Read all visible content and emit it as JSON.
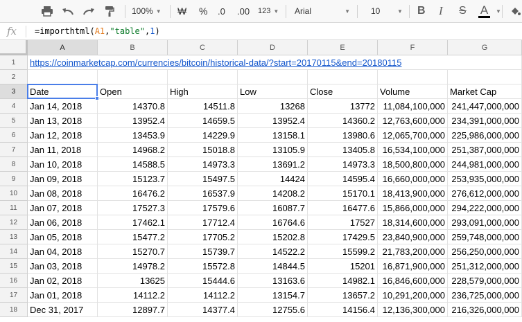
{
  "toolbar": {
    "zoom": "100%",
    "currency_symbol": "₩",
    "percent_symbol": "%",
    "decrease_decimals": ".0",
    "increase_decimals": ".00",
    "more_formats": "123",
    "font": "Arial",
    "font_size": "10",
    "bold": "B",
    "italic": "I",
    "strikethrough": "S",
    "text_color": "A"
  },
  "formula_bar": {
    "fx_label": "fx",
    "formula_parts": [
      "=importhtml(",
      "A1",
      ",",
      "\"table\"",
      ",",
      "1",
      ")"
    ]
  },
  "columns": [
    "A",
    "B",
    "C",
    "D",
    "E",
    "F",
    "G"
  ],
  "rows": [
    "1",
    "2",
    "3",
    "4",
    "5",
    "6",
    "7",
    "8",
    "9",
    "10",
    "11",
    "12",
    "13",
    "14",
    "15",
    "16",
    "17",
    "18"
  ],
  "url": "https://coinmarketcap.com/currencies/bitcoin/historical-data/?start=20170115&end=20180115",
  "table": {
    "headers": [
      "Date",
      "Open",
      "High",
      "Low",
      "Close",
      "Volume",
      "Market Cap"
    ],
    "rows": [
      [
        "Jan 14, 2018",
        "14370.8",
        "14511.8",
        "13268",
        "13772",
        "11,084,100,000",
        "241,447,000,000"
      ],
      [
        "Jan 13, 2018",
        "13952.4",
        "14659.5",
        "13952.4",
        "14360.2",
        "12,763,600,000",
        "234,391,000,000"
      ],
      [
        "Jan 12, 2018",
        "13453.9",
        "14229.9",
        "13158.1",
        "13980.6",
        "12,065,700,000",
        "225,986,000,000"
      ],
      [
        "Jan 11, 2018",
        "14968.2",
        "15018.8",
        "13105.9",
        "13405.8",
        "16,534,100,000",
        "251,387,000,000"
      ],
      [
        "Jan 10, 2018",
        "14588.5",
        "14973.3",
        "13691.2",
        "14973.3",
        "18,500,800,000",
        "244,981,000,000"
      ],
      [
        "Jan 09, 2018",
        "15123.7",
        "15497.5",
        "14424",
        "14595.4",
        "16,660,000,000",
        "253,935,000,000"
      ],
      [
        "Jan 08, 2018",
        "16476.2",
        "16537.9",
        "14208.2",
        "15170.1",
        "18,413,900,000",
        "276,612,000,000"
      ],
      [
        "Jan 07, 2018",
        "17527.3",
        "17579.6",
        "16087.7",
        "16477.6",
        "15,866,000,000",
        "294,222,000,000"
      ],
      [
        "Jan 06, 2018",
        "17462.1",
        "17712.4",
        "16764.6",
        "17527",
        "18,314,600,000",
        "293,091,000,000"
      ],
      [
        "Jan 05, 2018",
        "15477.2",
        "17705.2",
        "15202.8",
        "17429.5",
        "23,840,900,000",
        "259,748,000,000"
      ],
      [
        "Jan 04, 2018",
        "15270.7",
        "15739.7",
        "14522.2",
        "15599.2",
        "21,783,200,000",
        "256,250,000,000"
      ],
      [
        "Jan 03, 2018",
        "14978.2",
        "15572.8",
        "14844.5",
        "15201",
        "16,871,900,000",
        "251,312,000,000"
      ],
      [
        "Jan 02, 2018",
        "13625",
        "15444.6",
        "13163.6",
        "14982.1",
        "16,846,600,000",
        "228,579,000,000"
      ],
      [
        "Jan 01, 2018",
        "14112.2",
        "14112.2",
        "13154.7",
        "13657.2",
        "10,291,200,000",
        "236,725,000,000"
      ],
      [
        "Dec 31, 2017",
        "12897.7",
        "14377.4",
        "12755.6",
        "14156.4",
        "12,136,300,000",
        "216,326,000,000"
      ]
    ]
  },
  "selected_cell": "A3"
}
